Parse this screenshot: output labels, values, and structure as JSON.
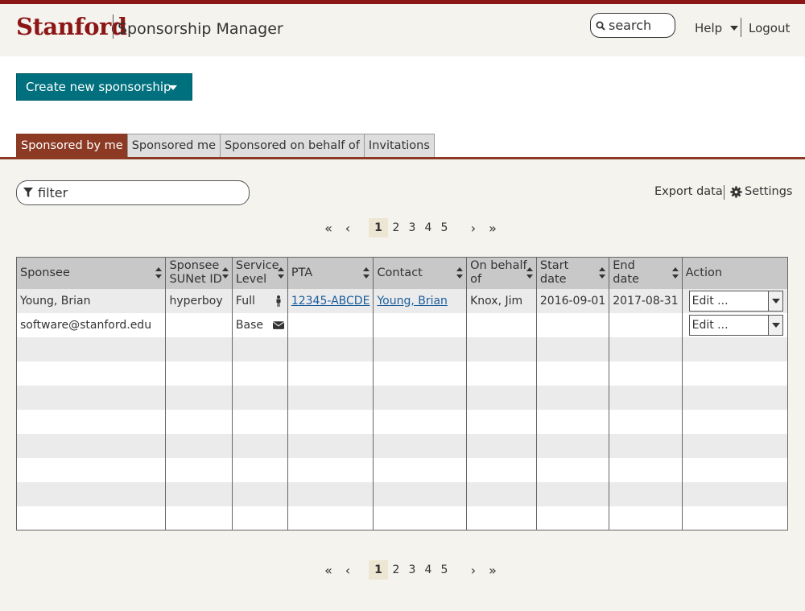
{
  "header": {
    "brand": "Stanford",
    "app_title": "Sponsorship Manager",
    "search_placeholder": "search",
    "help_label": "Help",
    "logout_label": "Logout"
  },
  "toolbar": {
    "create_label": "Create new sponsorship"
  },
  "tabs": [
    {
      "label": "Sponsored by me",
      "active": true
    },
    {
      "label": "Sponsored me",
      "active": false
    },
    {
      "label": "Sponsored on behalf of",
      "active": false
    },
    {
      "label": "Invitations",
      "active": false
    }
  ],
  "filter": {
    "placeholder": "filter"
  },
  "actions": {
    "export_label": "Export data",
    "settings_label": "Settings"
  },
  "pager": {
    "first": "«",
    "prev": "‹",
    "next": "›",
    "last": "»",
    "pages": [
      "1",
      "2",
      "3",
      "4",
      "5"
    ],
    "current": "1"
  },
  "table": {
    "columns": [
      {
        "line1": "Sponsee",
        "line2": ""
      },
      {
        "line1": "Sponsee",
        "line2": "SUNet ID"
      },
      {
        "line1": "Service",
        "line2": "Level"
      },
      {
        "line1": "PTA",
        "line2": ""
      },
      {
        "line1": "Contact",
        "line2": ""
      },
      {
        "line1": "On behalf",
        "line2": "of"
      },
      {
        "line1": "Start",
        "line2": "date"
      },
      {
        "line1": "End",
        "line2": "date"
      },
      {
        "line1": "Action",
        "line2": ""
      }
    ],
    "rows": [
      {
        "sponsee": "Young, Brian",
        "sunetid": "hyperboy",
        "service": "Full",
        "service_icon": "person-icon",
        "pta": "12345-ABCDE",
        "contact": "Young, Brian",
        "behalf": "Knox, Jim",
        "start": "2016-09-01",
        "end": "2017-08-31",
        "action": "Edit ..."
      },
      {
        "sponsee": "software@stanford.edu",
        "sunetid": "",
        "service": "Base",
        "service_icon": "envelope-icon",
        "pta": "",
        "contact": "",
        "behalf": "",
        "start": "",
        "end": "",
        "action": "Edit ..."
      }
    ]
  },
  "colors": {
    "brand": "#8c1515",
    "primary_button": "#00707f",
    "active_tab": "#8c3a24",
    "link": "#1a5d9c"
  }
}
